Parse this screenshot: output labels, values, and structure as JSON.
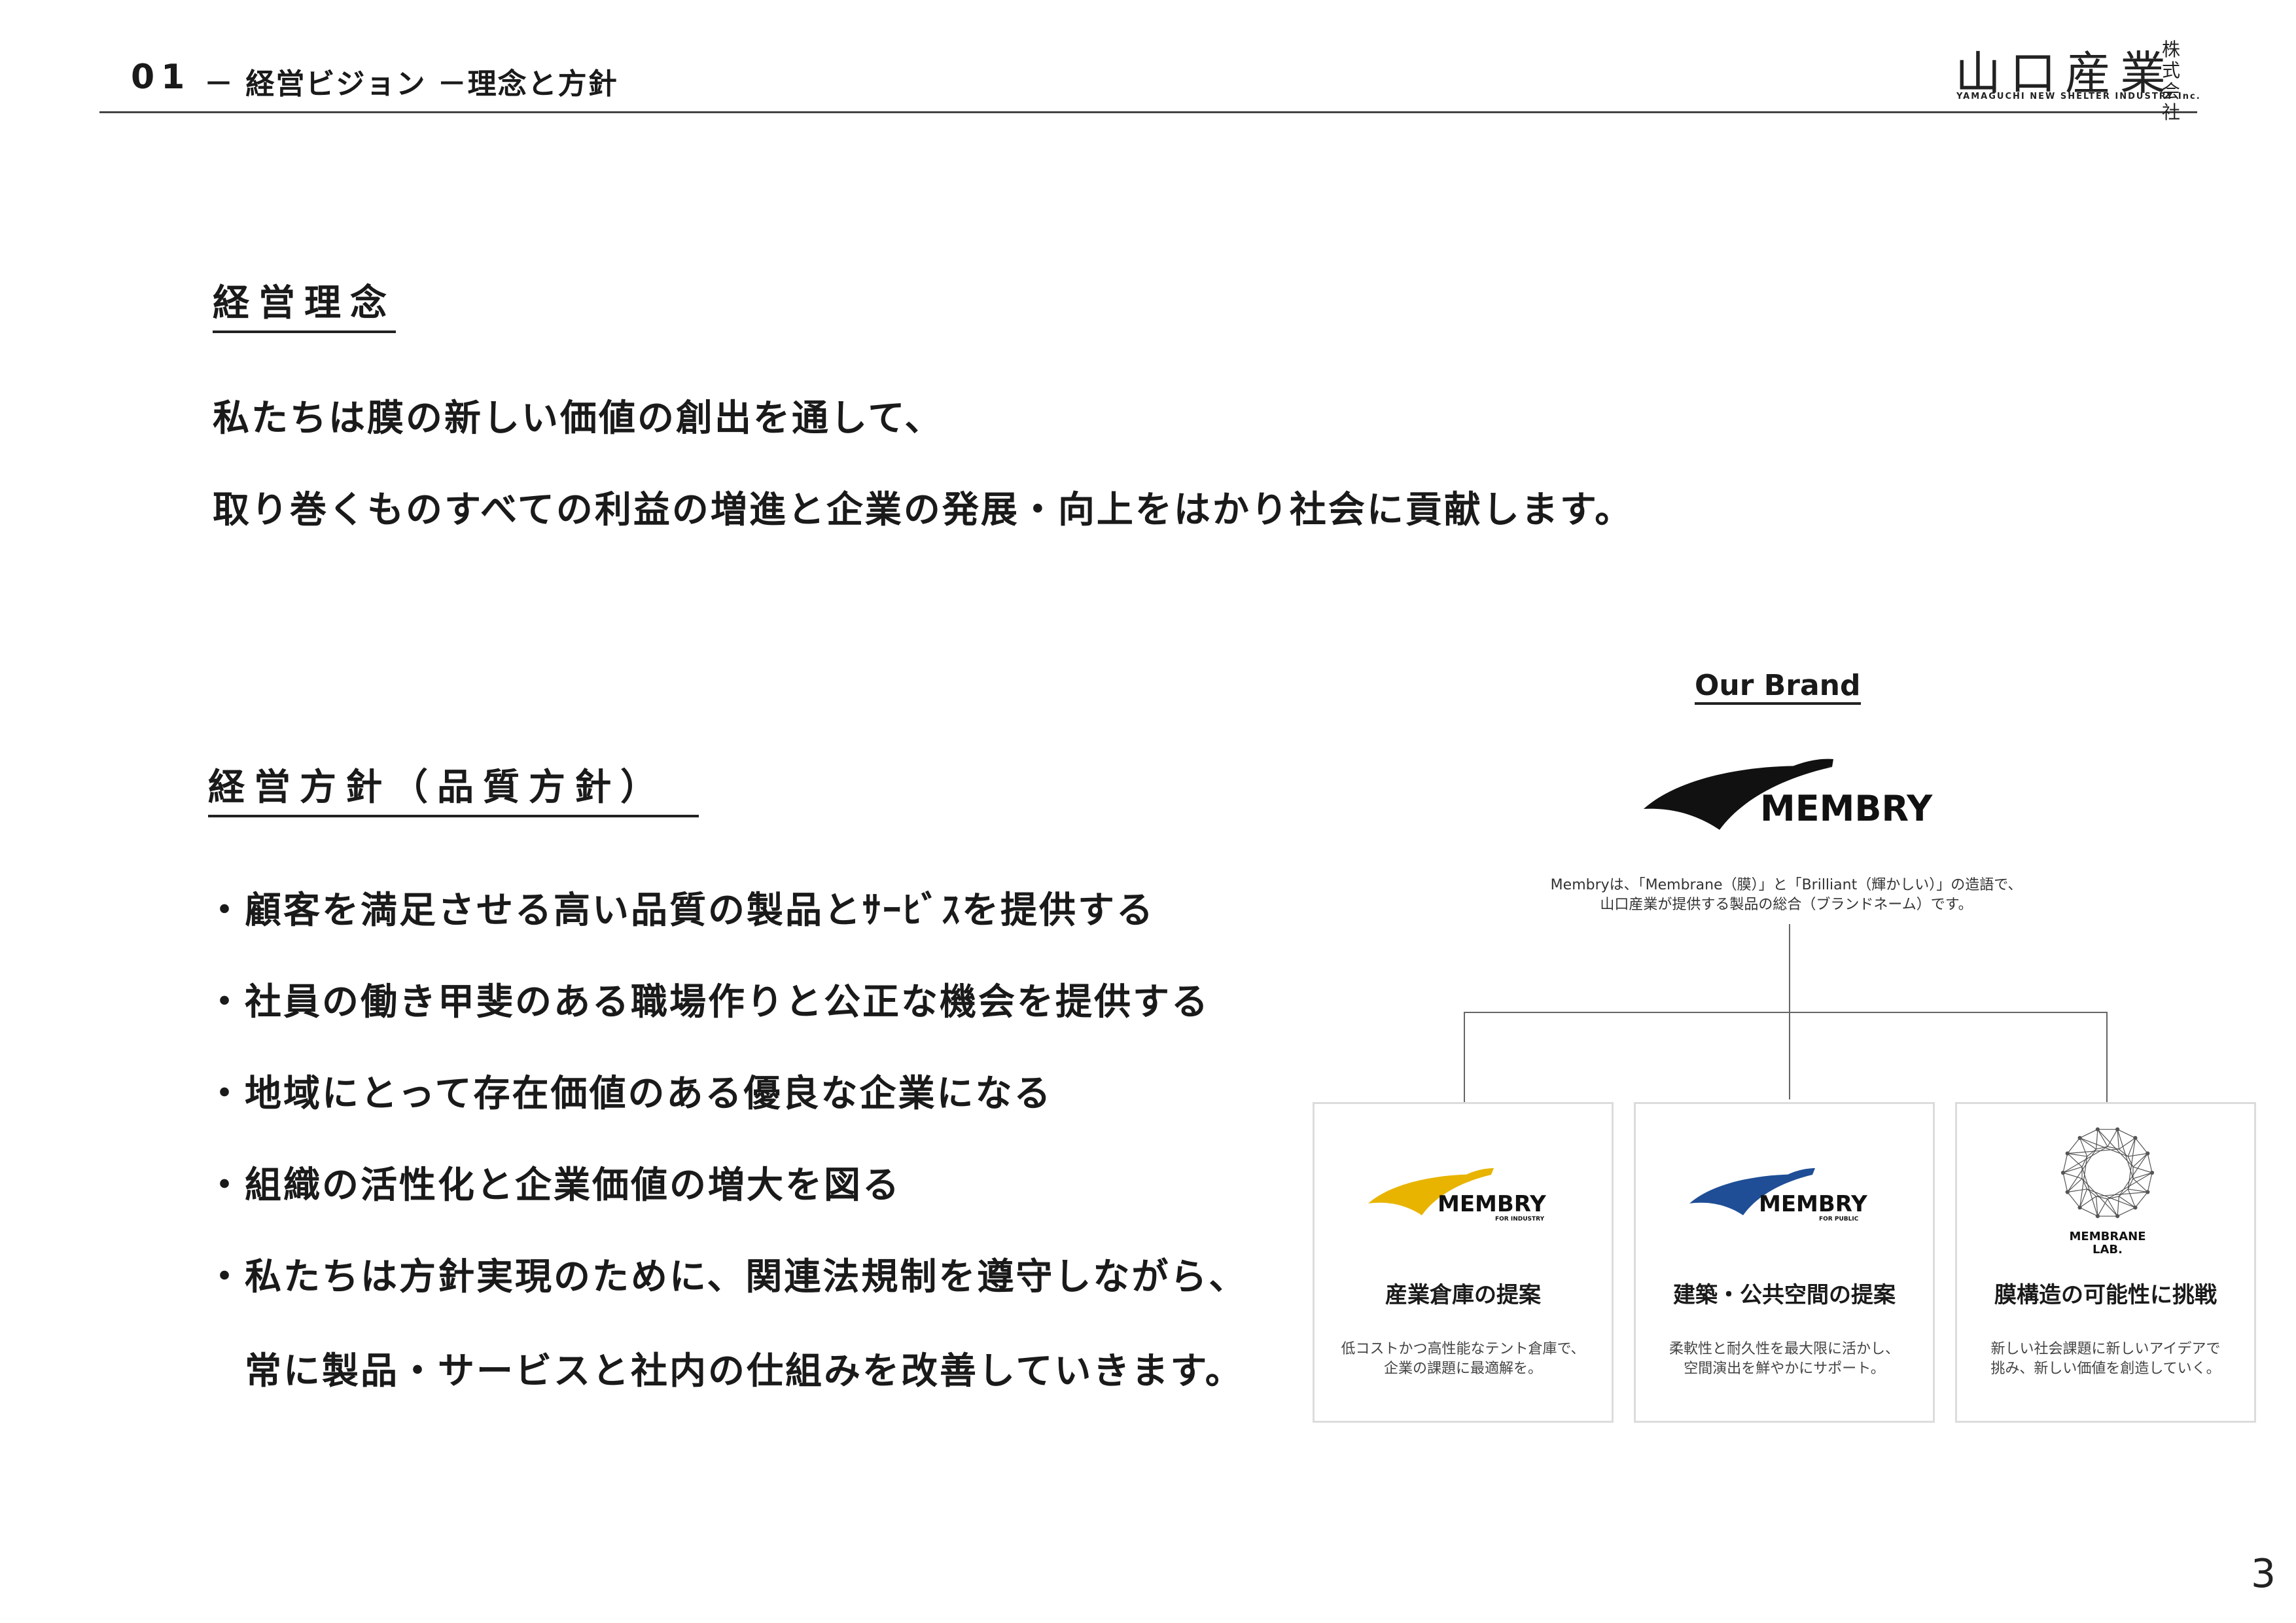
{
  "header": {
    "number": "01",
    "title": "－ 経営ビジョン －理念と方針"
  },
  "company_logo": {
    "main": "山口産業",
    "kabushiki": "株式",
    "kaisha": "会社",
    "sub": "YAMAGUCHI NEW SHELTER INDUSTRY Inc."
  },
  "philosophy": {
    "heading": "経営理念",
    "lines": [
      "私たちは膜の新しい価値の創出を通して、",
      "取り巻くものすべての利益の増進と企業の発展・向上をはかり社会に貢献します。"
    ]
  },
  "policy": {
    "heading": "経営方針（品質方針）",
    "items": [
      "・顧客を満足させる高い品質の製品とｻｰﾋﾞｽを提供する",
      "・社員の働き甲斐のある職場作りと公正な機会を提供する",
      "・地域にとって存在価値のある優良な企業になる",
      "・組織の活性化と企業価値の増大を図る",
      "・私たちは方針実現のために、関連法規制を遵守しながら、",
      "　常に製品・サービスと社内の仕組みを改善していきます。"
    ]
  },
  "brand": {
    "title": "Our Brand",
    "logo_text": "MEMBRY",
    "description_lines": [
      "Membryは、「Membrane（膜）」と「Brilliant（輝かしい）」の造語で、",
      "山口産業が提供する製品の総合（ブランドネーム）です。"
    ],
    "cards": [
      {
        "logo_text": "MEMBRY",
        "logo_sub": "FOR INDUSTRY",
        "logo_color": "#e8b400",
        "title": "産業倉庫の提案",
        "desc_lines": [
          "低コストかつ高性能なテント倉庫で、",
          "企業の課題に最適解を。"
        ]
      },
      {
        "logo_text": "MEMBRY",
        "logo_sub": "FOR PUBLIC",
        "logo_color": "#1f4e96",
        "title": "建築・公共空間の提案",
        "desc_lines": [
          "柔軟性と耐久性を最大限に活かし、",
          "空間演出を鮮やかにサポート。"
        ]
      },
      {
        "logo_text_line1": "MEMBRANE",
        "logo_text_line2": "LAB.",
        "title": "膜構造の可能性に挑戦",
        "desc_lines": [
          "新しい社会課題に新しいアイデアで",
          "挑み、新しい価値を創造していく。"
        ]
      }
    ]
  },
  "page_number": "3"
}
